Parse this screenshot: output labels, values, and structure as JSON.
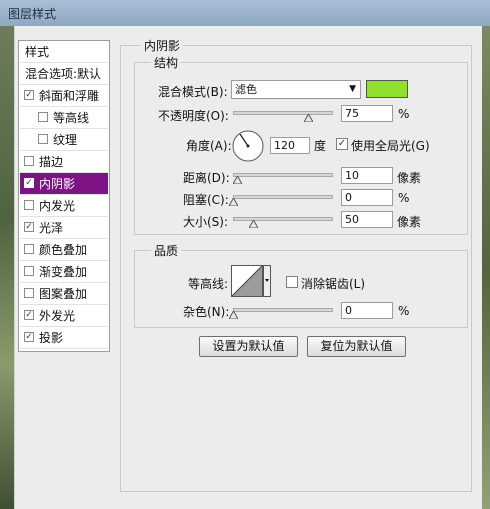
{
  "window": {
    "title": "图层样式"
  },
  "sidebar": {
    "header": "样式",
    "blend_options": "混合选项:默认",
    "items": [
      {
        "label": "斜面和浮雕",
        "checked": true
      },
      {
        "label": "等高线",
        "checked": false
      },
      {
        "label": "纹理",
        "checked": false
      },
      {
        "label": "描边",
        "checked": false
      },
      {
        "label": "内阴影",
        "checked": true,
        "selected": true
      },
      {
        "label": "内发光",
        "checked": false
      },
      {
        "label": "光泽",
        "checked": true
      },
      {
        "label": "颜色叠加",
        "checked": false
      },
      {
        "label": "渐变叠加",
        "checked": false
      },
      {
        "label": "图案叠加",
        "checked": false
      },
      {
        "label": "外发光",
        "checked": true
      },
      {
        "label": "投影",
        "checked": true
      }
    ]
  },
  "panel": {
    "title": "内阴影",
    "structure": {
      "title": "结构",
      "blend_mode_label": "混合模式(B):",
      "blend_mode_value": "滤色",
      "blend_color": "#8ee02a",
      "opacity_label": "不透明度(O):",
      "opacity_value": "75",
      "opacity_unit": "%",
      "opacity_level": 75,
      "angle_label": "角度(A):",
      "angle_value": "120",
      "angle_unit": "度",
      "global_light_label": "使用全局光(G)",
      "global_light_checked": true,
      "distance_label": "距离(D):",
      "distance_value": "10",
      "distance_unit": "像素",
      "distance_level": 4,
      "choke_label": "阻塞(C):",
      "choke_value": "0",
      "choke_unit": "%",
      "choke_level": 0,
      "size_label": "大小(S):",
      "size_value": "50",
      "size_unit": "像素",
      "size_level": 20
    },
    "quality": {
      "title": "品质",
      "contour_label": "等高线:",
      "antialias_label": "消除锯齿(L)",
      "antialias_checked": false,
      "noise_label": "杂色(N):",
      "noise_value": "0",
      "noise_unit": "%",
      "noise_level": 0
    },
    "buttons": {
      "make_default": "设置为默认值",
      "reset_default": "复位为默认值"
    }
  }
}
